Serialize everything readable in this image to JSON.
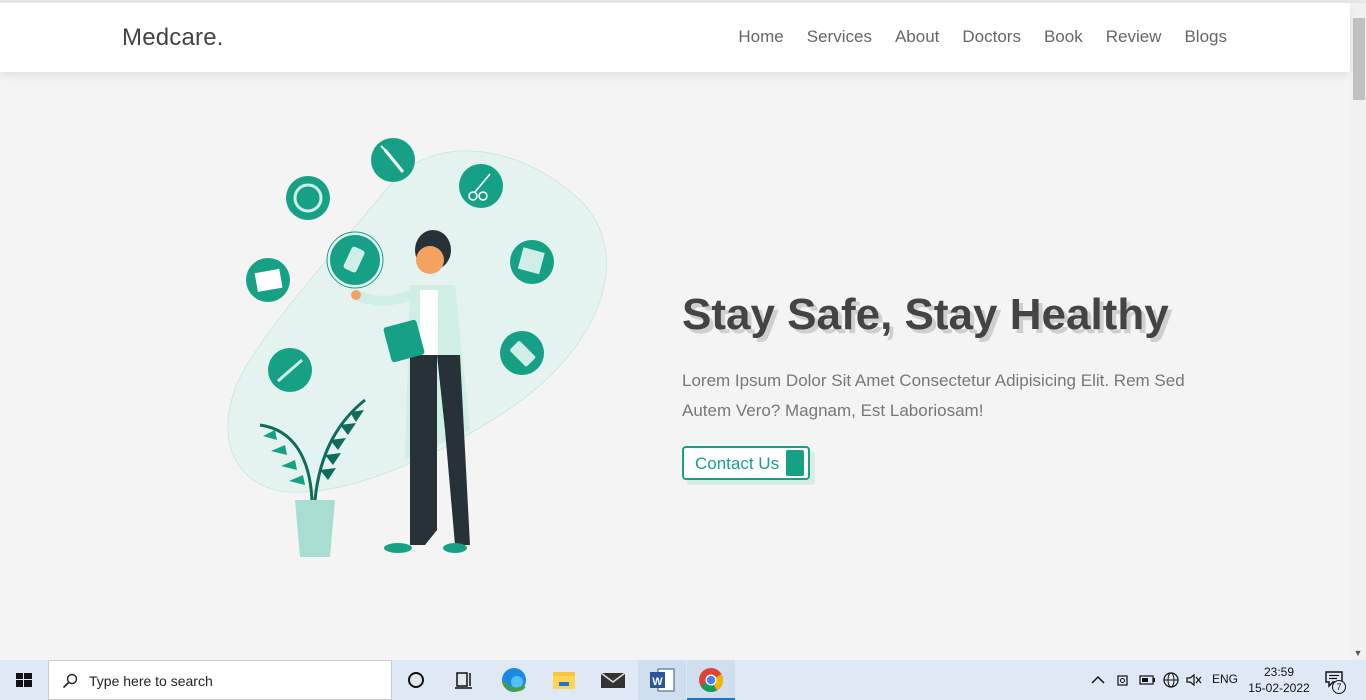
{
  "header": {
    "logo": "Medcare.",
    "nav": [
      "Home",
      "Services",
      "About",
      "Doctors",
      "Book",
      "Review",
      "Blogs"
    ]
  },
  "hero": {
    "title": "Stay Safe, Stay Healthy",
    "text": "Lorem Ipsum Dolor Sit Amet Consectetur Adipisicing Elit. Rem Sed Autem Vero? Magnam, Est Laboriosam!",
    "button": "Contact Us"
  },
  "taskbar": {
    "search_placeholder": "Type here to search",
    "lang": "ENG",
    "time": "23:59",
    "date": "15-02-2022",
    "notification_count": "7"
  },
  "colors": {
    "accent": "#16a085",
    "light_accent": "#e4f3f0",
    "text": "#444444"
  },
  "icons": [
    "windows-icon",
    "search-icon",
    "cortana-icon",
    "task-view-icon",
    "edge-icon",
    "file-explorer-icon",
    "mail-icon",
    "word-icon",
    "chrome-icon"
  ]
}
